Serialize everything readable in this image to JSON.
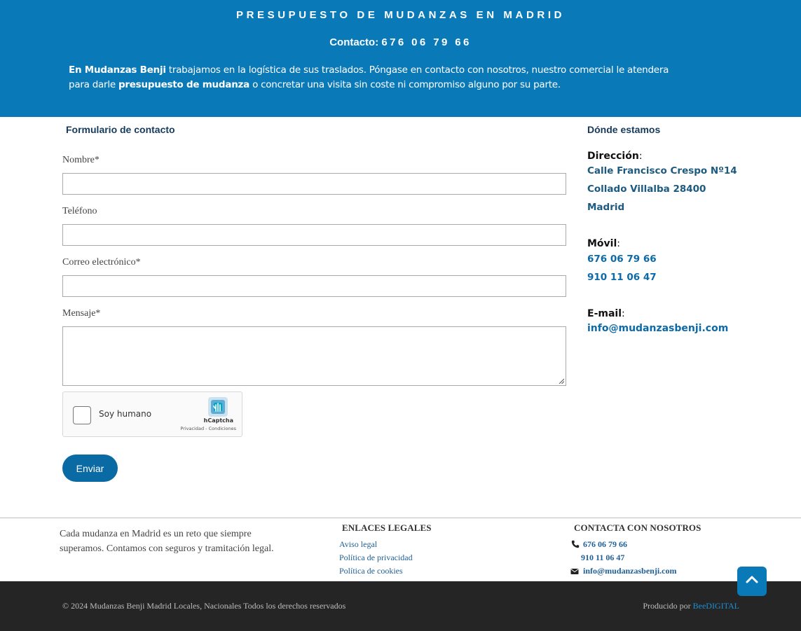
{
  "hero": {
    "title": "PRESUPUESTO DE MUDANZAS EN MADRID",
    "contact_label": "Contacto: ",
    "contact_number": "676 06 79 66",
    "intro_bold_1": "En Mudanzas Benji",
    "intro_text_1": " trabajamos en la logística de sus traslados. Póngase en contacto con nosotros, nuestro comercial le atendera para darle ",
    "intro_bold_2": "presupuesto de mudanza",
    "intro_text_2": " o concretar una visita sin coste ni compromiso alguno por su parte."
  },
  "form": {
    "title": "Formulario de contacto",
    "name_label": "Nombre*",
    "phone_label": "Teléfono",
    "email_label": "Correo electrónico*",
    "message_label": "Mensaje*",
    "name_value": "",
    "phone_value": "",
    "email_value": "",
    "message_value": "",
    "captcha_label": "Soy humano",
    "captcha_brand": "hCaptcha",
    "captcha_links": "Privacidad - Condiciones",
    "submit_label": "Enviar"
  },
  "location": {
    "title": "Dónde estamos",
    "address_label": "Dirección",
    "address_line1": "Calle Francisco Crespo Nº14",
    "address_line2": "Collado Villalba 28400",
    "address_line3": "Madrid",
    "mobile_label": "Móvil",
    "mobile_1": "676 06 79 66",
    "mobile_2": "910 11 06 47",
    "email_label": "E-mail",
    "email": "info@mudanzasbenji.com",
    "colon": ":"
  },
  "footer": {
    "about": "Cada mudanza en Madrid es un reto que siempre superamos. Contamos con seguros y tramitación legal.",
    "legal_title": "ENLACES LEGALES",
    "legal_links": [
      "Aviso legal",
      "Política de privacidad",
      "Política de cookies"
    ],
    "contact_title": "CONTACTA CON NOSOTROS",
    "phone_1": "676 06 79 66",
    "phone_2": "910 11 06 47",
    "email": "info@mudanzasbenji.com",
    "copyright": "© 2024 Mudanzas Benji Madrid Locales, Nacionales Todos los derechos reservados",
    "produced_label": "Producido por ",
    "produced_brand": "BeeDIGITAL"
  },
  "icons": {
    "phone": "phone-icon",
    "envelope": "envelope-icon",
    "to_top": "chevron-up-icon",
    "captcha": "hcaptcha-logo-icon",
    "resize": "resize-grip-icon"
  },
  "colors": {
    "brand_blue": "#0a79b8",
    "button_blue": "#0a6aa4",
    "link_blue": "#0d6aa8",
    "footer_dark": "#252525"
  }
}
